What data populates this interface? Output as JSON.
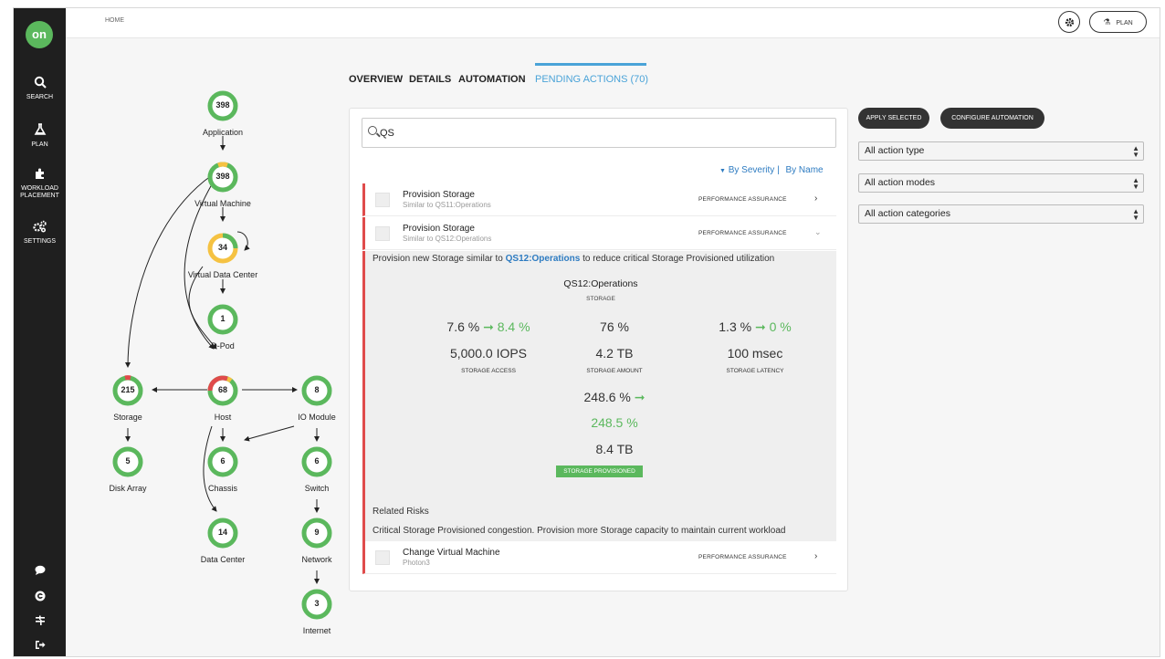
{
  "sidebar": {
    "logo": "on",
    "items": [
      {
        "label": "SEARCH",
        "icon": "search-icon"
      },
      {
        "label": "PLAN",
        "icon": "flask-icon"
      },
      {
        "label": "WORKLOAD PLACEMENT",
        "icon": "puzzle-icon"
      },
      {
        "label": "SETTINGS",
        "icon": "gears-icon"
      }
    ],
    "bottom_icons": [
      "chat-icon",
      "help-icon",
      "filter-icon",
      "logout-icon"
    ]
  },
  "header": {
    "breadcrumb": "HOME",
    "plan_label": "PLAN"
  },
  "supply_chain": {
    "nodes": [
      {
        "id": "application",
        "label": "Application",
        "count": "398"
      },
      {
        "id": "virtual-machine",
        "label": "Virtual Machine",
        "count": "398"
      },
      {
        "id": "virtual-data-center",
        "label": "Virtual Data Center",
        "count": "34"
      },
      {
        "id": "d-pod",
        "label": "D-Pod",
        "count": "1"
      },
      {
        "id": "storage",
        "label": "Storage",
        "count": "215"
      },
      {
        "id": "host",
        "label": "Host",
        "count": "68"
      },
      {
        "id": "io-module",
        "label": "IO Module",
        "count": "8"
      },
      {
        "id": "disk-array",
        "label": "Disk Array",
        "count": "5"
      },
      {
        "id": "chassis",
        "label": "Chassis",
        "count": "6"
      },
      {
        "id": "switch",
        "label": "Switch",
        "count": "6"
      },
      {
        "id": "data-center",
        "label": "Data Center",
        "count": "14"
      },
      {
        "id": "network",
        "label": "Network",
        "count": "9"
      },
      {
        "id": "internet",
        "label": "Internet",
        "count": "3"
      }
    ],
    "colors": {
      "ok": "#5bb85d",
      "warning": "#f5c242",
      "critical": "#e04b4b"
    }
  },
  "tabs": [
    {
      "label": "OVERVIEW"
    },
    {
      "label": "DETAILS"
    },
    {
      "label": "AUTOMATION"
    },
    {
      "label": "PENDING ACTIONS (70)",
      "active": true
    }
  ],
  "search": {
    "value": "QS",
    "placeholder": ""
  },
  "sort": {
    "by_severity": "By Severity",
    "separator": "|",
    "by_name": "By Name"
  },
  "actions": [
    {
      "title": "Provision Storage",
      "subtitle": "Similar to QS11:Operations",
      "category": "PERFORMANCE ASSURANCE",
      "expanded": false
    },
    {
      "title": "Provision Storage",
      "subtitle": "Similar to QS12:Operations",
      "category": "PERFORMANCE ASSURANCE",
      "expanded": true
    },
    {
      "title": "Change Virtual Machine",
      "subtitle": "Photon3",
      "category": "PERFORMANCE ASSURANCE",
      "expanded": false
    }
  ],
  "detail": {
    "desc_prefix": "Provision new Storage similar to ",
    "desc_link": "QS12:Operations",
    "desc_suffix": " to reduce critical Storage Provisioned utilization",
    "entity_name": "QS12:Operations",
    "entity_type": "STORAGE",
    "metrics": [
      {
        "from": "7.6 %",
        "to": "8.4 %",
        "value": "5,000.0 IOPS",
        "label": "STORAGE ACCESS"
      },
      {
        "from": "76 %",
        "to": "",
        "value": "4.2 TB",
        "label": "STORAGE AMOUNT"
      },
      {
        "from": "1.3 %",
        "to": "0 %",
        "value": "100 msec",
        "label": "STORAGE LATENCY"
      }
    ],
    "provisioned": {
      "from": "248.6 %",
      "to": "248.5 %",
      "value": "8.4 TB",
      "label": "STORAGE PROVISIONED"
    },
    "related_risks_title": "Related Risks",
    "related_risks_text": "Critical Storage Provisioned congestion. Provision more Storage capacity to maintain current workload"
  },
  "controls": {
    "apply_selected": "APPLY SELECTED",
    "configure_automation": "CONFIGURE AUTOMATION",
    "filters": [
      "All action type",
      "All action modes",
      "All action categories"
    ]
  }
}
